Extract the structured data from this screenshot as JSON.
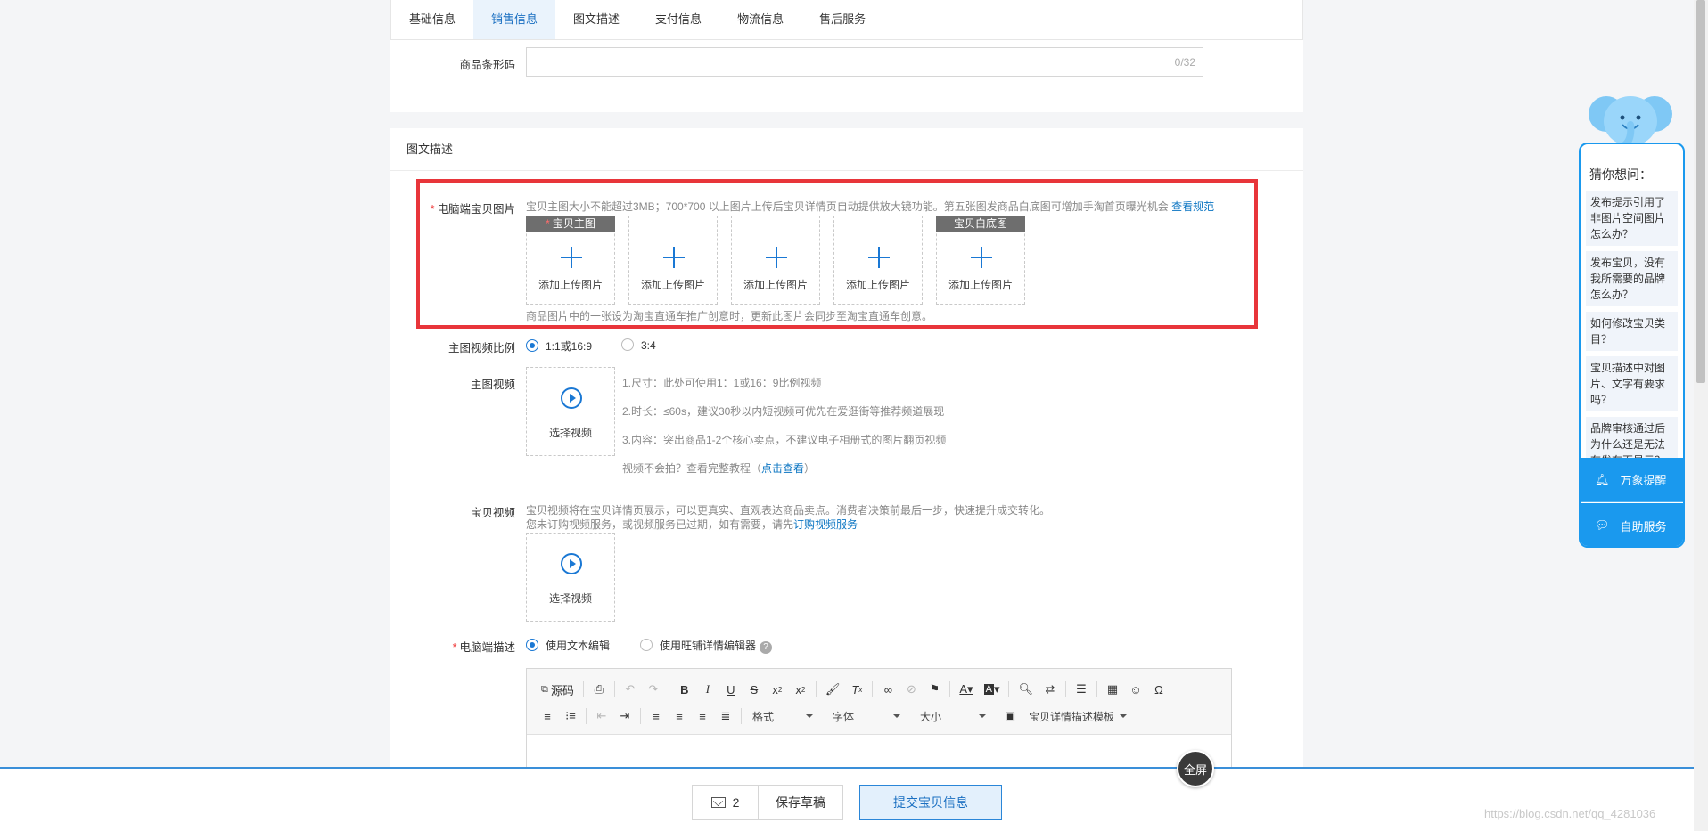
{
  "tabs": [
    "基础信息",
    "销售信息",
    "图文描述",
    "支付信息",
    "物流信息",
    "售后服务"
  ],
  "active_tab_index": 1,
  "barcode": {
    "label": "商品条形码",
    "value": "",
    "counter": "0/32"
  },
  "section_title": "图文描述",
  "pc_images": {
    "label": "电脑端宝贝图片",
    "tip": "宝贝主图大小不能超过3MB；700*700 以上图片上传后宝贝详情页自动提供放大镜功能。第五张图发商品白底图可增加手淘首页曝光机会",
    "tip_link": "查看规范",
    "slots": [
      {
        "tag": "宝贝主图",
        "caption": "添加上传图片"
      },
      {
        "tag": "",
        "caption": "添加上传图片"
      },
      {
        "tag": "",
        "caption": "添加上传图片"
      },
      {
        "tag": "",
        "caption": "添加上传图片"
      },
      {
        "tag": "宝贝白底图",
        "caption": "添加上传图片"
      }
    ],
    "note": "商品图片中的一张设为淘宝直通车推广创意时，更新此图片会同步至淘宝直通车创意。"
  },
  "ratio": {
    "label": "主图视频比例",
    "options": [
      "1:1或16:9",
      "3:4"
    ],
    "selected": "1:1或16:9"
  },
  "main_video": {
    "label": "主图视频",
    "button": "选择视频",
    "lines": [
      "1.尺寸：此处可使用1：1或16：9比例视频",
      "2.时长：≤60s，建议30秒以内短视频可优先在爱逛街等推荐频道展现",
      "3.内容：突出商品1-2个核心卖点，不建议电子相册式的图片翻页视频"
    ],
    "tutorial_prefix": "视频不会拍？查看完整教程（",
    "tutorial_link": "点击查看",
    "tutorial_suffix": "）"
  },
  "item_video": {
    "label": "宝贝视频",
    "line1": "宝贝视频将在宝贝详情页展示，可以更真实、直观表达商品卖点。消费者决策前最后一步，快速提升成交转化。",
    "line2_prefix": "您未订购视频服务，或视频服务已过期，如有需要，请先",
    "line2_link": "订购视频服务",
    "button": "选择视频"
  },
  "pc_desc": {
    "label": "电脑端描述",
    "options": [
      "使用文本编辑",
      "使用旺铺详情编辑器"
    ],
    "selected": "使用文本编辑",
    "help": "?"
  },
  "editor": {
    "source_label": "源码",
    "format_label": "格式",
    "font_label": "字体",
    "size_label": "大小",
    "template_label": "宝贝详情描述模板"
  },
  "fullscreen_label": "全屏",
  "footer": {
    "message_count": "2",
    "draft_label": "保存草稿",
    "submit_label": "提交宝贝信息"
  },
  "watermark": "https://blog.csdn.net/qq_4281036",
  "help_widget": {
    "title": "猜你想问：",
    "questions": [
      "发布提示引用了非图片空间图片怎么办？",
      "发布宝贝，没有我所需要的品牌怎么办？",
      "如何修改宝贝类目？",
      "宝贝描述中对图片、文字有要求吗？",
      "品牌审核通过后为什么还是无法在发布页显示？"
    ],
    "remind_label": "万象提醒",
    "service_label": "自助服务"
  },
  "colors": {
    "accent": "#1a78d4",
    "highlight_border": "#e8353a",
    "help_blue": "#1a99ee"
  }
}
